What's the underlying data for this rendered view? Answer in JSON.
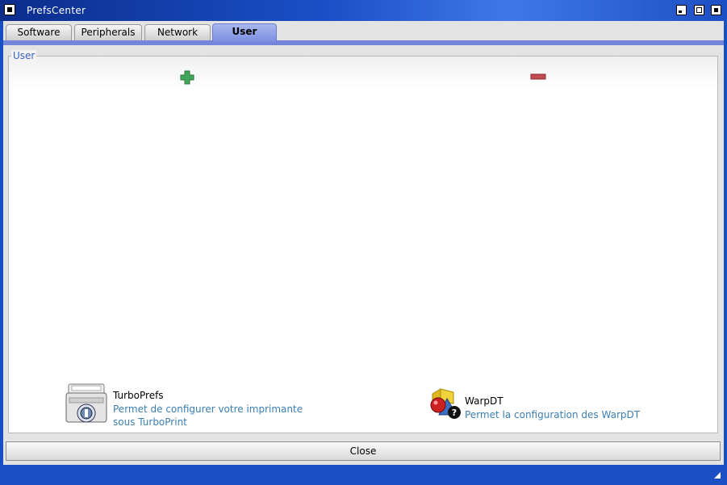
{
  "window": {
    "title": "PrefsCenter"
  },
  "tabs": [
    {
      "label": "Software",
      "active": false
    },
    {
      "label": "Peripherals",
      "active": false
    },
    {
      "label": "Network",
      "active": false
    },
    {
      "label": "User",
      "active": true
    }
  ],
  "panel": {
    "legend": "User",
    "add_icon": "plus-icon",
    "remove_icon": "minus-icon",
    "items": [
      {
        "title": "TurboPrefs",
        "description_line1": "Permet de configurer votre imprimante",
        "description_line2": "sous TurboPrint",
        "icon": "printer-icon"
      },
      {
        "title": "WarpDT",
        "description_line1": "Permet la configuration des WarpDT",
        "icon": "datatype-icon"
      }
    ]
  },
  "footer": {
    "close_label": "Close"
  },
  "colors": {
    "title_bar": "#1b4fc7",
    "active_tab": "#8a9be6",
    "link_text": "#3a7eb0"
  }
}
